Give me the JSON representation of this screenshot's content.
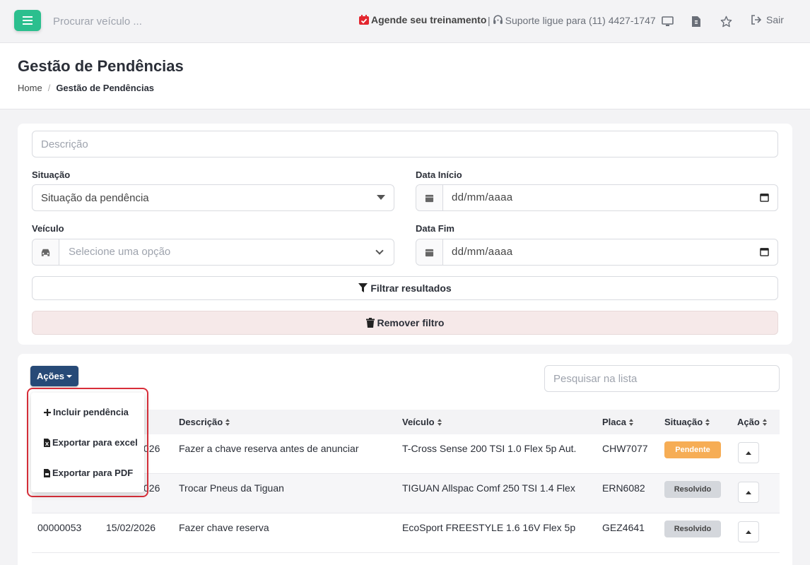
{
  "topbar": {
    "search_placeholder": "Procurar veículo ...",
    "training_label": "Agende seu treinamento",
    "support_separator": "|",
    "support_label": "Suporte ligue para (11) 4427-1747",
    "logout_label": "Sair",
    "accent": "#2bbf8e"
  },
  "header": {
    "title": "Gestão de Pendências",
    "breadcrumb_home": "Home",
    "breadcrumb_sep": "/",
    "breadcrumb_current": "Gestão de Pendências"
  },
  "filters": {
    "descricao_placeholder": "Descrição",
    "situacao_label": "Situação",
    "situacao_value": "Situação da pendência",
    "data_inicio_label": "Data Início",
    "data_inicio_value": "dd/mm/aaaa",
    "veiculo_label": "Veículo",
    "veiculo_placeholder": "Selecione uma opção",
    "data_fim_label": "Data Fim",
    "data_fim_value": "dd/mm/aaaa",
    "filter_button": "Filtrar resultados",
    "remove_button": "Remover filtro"
  },
  "list": {
    "actions_button": "Ações",
    "search_placeholder": "Pesquisar na lista",
    "dropdown": {
      "include": "Incluir pendência",
      "excel": "Exportar para excel",
      "pdf": "Exportar para PDF"
    },
    "columns": {
      "descricao": "Descrição",
      "veiculo": "Veículo",
      "placa": "Placa",
      "situacao": "Situação",
      "acao": "Ação"
    },
    "rows": [
      {
        "id": "",
        "date": "026",
        "descricao": "Fazer a chave reserva antes de anunciar",
        "veiculo": "T-Cross Sense 200 TSI 1.0 Flex 5p Aut.",
        "placa": "CHW7077",
        "situacao": "Pendente"
      },
      {
        "id": "",
        "date": "026",
        "descricao": "Trocar Pneus da Tiguan",
        "veiculo": "TIGUAN Allspac Comf 250 TSI 1.4 Flex",
        "placa": "ERN6082",
        "situacao": "Resolvido"
      },
      {
        "id": "00000053",
        "date": "15/02/2026",
        "descricao": "Fazer chave reserva",
        "veiculo": "EcoSport FREESTYLE 1.6 16V Flex 5p",
        "placa": "GEZ4641",
        "situacao": "Resolvido"
      }
    ],
    "status_colors": {
      "pendente": "#f6ad55",
      "resolvido": "#d4d7dc"
    }
  }
}
